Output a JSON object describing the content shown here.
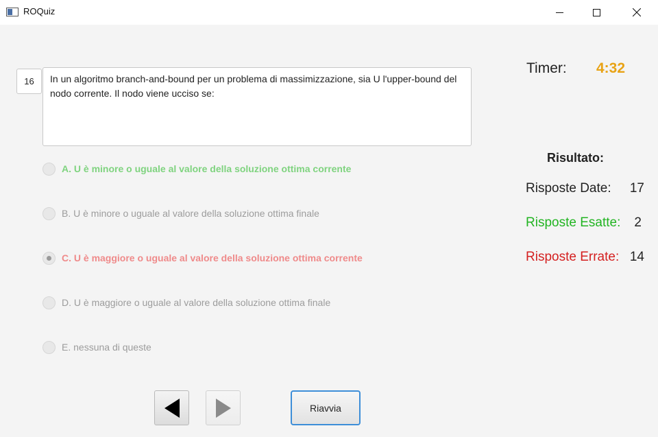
{
  "window": {
    "title": "ROQuiz"
  },
  "question": {
    "number": "16",
    "text": "In un algoritmo branch-and-bound per un problema di massimizzazione, sia U l'upper-bound del nodo corrente. Il nodo viene ucciso se:"
  },
  "options": [
    {
      "label": "A. U è minore o uguale al valore della soluzione ottima corrente",
      "state": "correct"
    },
    {
      "label": "B. U è minore o uguale al valore della soluzione ottima finale",
      "state": "neutral"
    },
    {
      "label": "C. U è maggiore o uguale al valore della soluzione ottima corrente",
      "state": "wrong-selected"
    },
    {
      "label": "D. U è maggiore o uguale al valore della soluzione ottima finale",
      "state": "neutral"
    },
    {
      "label": "E. nessuna di queste",
      "state": "neutral"
    }
  ],
  "timer": {
    "label": "Timer:",
    "value": "4:32",
    "color": "#e8a316"
  },
  "results": {
    "title": "Risultato:",
    "answered_label": "Risposte Date:",
    "answered_value": "17",
    "correct_label": "Risposte Esatte:",
    "correct_value": "2",
    "correct_color": "#22b422",
    "wrong_label": "Risposte Errate:",
    "wrong_value": "14",
    "wrong_color": "#d42020"
  },
  "buttons": {
    "prev_icon": "triangle-left-icon",
    "next_icon": "triangle-right-icon",
    "restart_label": "Riavvia"
  }
}
